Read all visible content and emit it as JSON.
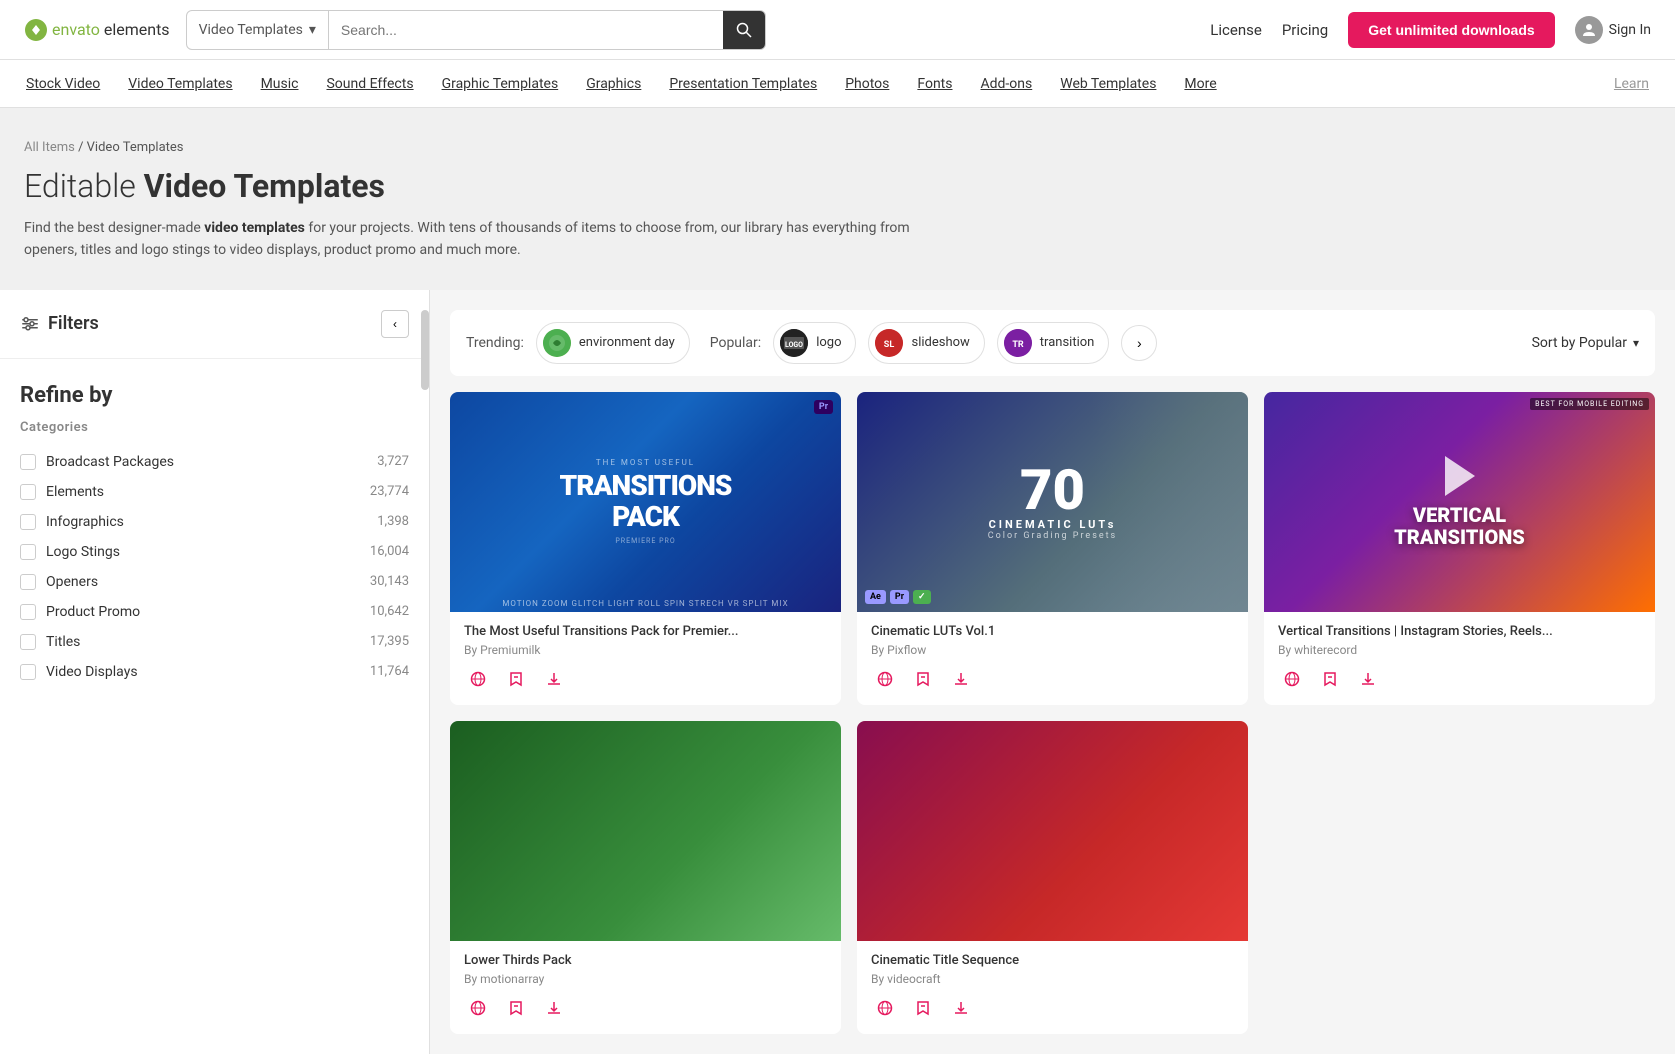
{
  "header": {
    "logo_envato": "envato",
    "logo_elements": "elements",
    "search_category": "Video Templates",
    "search_placeholder": "Search...",
    "nav_license": "License",
    "nav_pricing": "Pricing",
    "cta_button": "Get unlimited downloads",
    "sign_in": "Sign In"
  },
  "nav_items": [
    {
      "label": "Stock Video",
      "id": "stock-video"
    },
    {
      "label": "Video Templates",
      "id": "video-templates"
    },
    {
      "label": "Music",
      "id": "music"
    },
    {
      "label": "Sound Effects",
      "id": "sound-effects"
    },
    {
      "label": "Graphic Templates",
      "id": "graphic-templates"
    },
    {
      "label": "Graphics",
      "id": "graphics"
    },
    {
      "label": "Presentation Templates",
      "id": "presentation-templates"
    },
    {
      "label": "Photos",
      "id": "photos"
    },
    {
      "label": "Fonts",
      "id": "fonts"
    },
    {
      "label": "Add-ons",
      "id": "add-ons"
    },
    {
      "label": "Web Templates",
      "id": "web-templates"
    },
    {
      "label": "More",
      "id": "more"
    },
    {
      "label": "Learn",
      "id": "learn"
    }
  ],
  "breadcrumb": {
    "all_items": "All Items",
    "separator": "/",
    "current": "Video Templates"
  },
  "page": {
    "title_light": "Editable",
    "title_bold": "Video Templates",
    "description": "Find the best designer-made video templates for your projects. With tens of thousands of items to choose from, our library has everything from openers, titles and logo stings to video displays, product promo and much more.",
    "description_bold": "video templates"
  },
  "sidebar": {
    "filters_label": "Filters",
    "refine_by": "Refine by",
    "categories_label": "Categories",
    "categories": [
      {
        "name": "Broadcast Packages",
        "count": "3,727"
      },
      {
        "name": "Elements",
        "count": "23,774"
      },
      {
        "name": "Infographics",
        "count": "1,398"
      },
      {
        "name": "Logo Stings",
        "count": "16,004"
      },
      {
        "name": "Openers",
        "count": "30,143"
      },
      {
        "name": "Product Promo",
        "count": "10,642"
      },
      {
        "name": "Titles",
        "count": "17,395"
      },
      {
        "name": "Video Displays",
        "count": "11,764"
      }
    ]
  },
  "trending": {
    "trending_label": "Trending:",
    "popular_label": "Popular:",
    "tags": [
      {
        "label": "environment day",
        "id": "env-day"
      },
      {
        "label": "logo",
        "id": "logo"
      },
      {
        "label": "slideshow",
        "id": "slideshow"
      },
      {
        "label": "transition",
        "id": "transition"
      }
    ],
    "sort_by": "Sort by Popular"
  },
  "items": [
    {
      "id": "item-1",
      "title": "The Most Useful Transitions Pack for Premier...",
      "author": "By Premiumilk",
      "thumb_type": "transitions"
    },
    {
      "id": "item-2",
      "title": "Cinematic LUTs Vol.1",
      "author": "By Pixflow",
      "thumb_type": "luts"
    },
    {
      "id": "item-3",
      "title": "Vertical Transitions | Instagram Stories, Reels...",
      "author": "By whiterecord",
      "thumb_type": "vertical"
    },
    {
      "id": "item-4",
      "title": "Lower Thirds Pack",
      "author": "By motionarray",
      "thumb_type": "lower"
    },
    {
      "id": "item-5",
      "title": "Cinematic Title Sequence",
      "author": "By videocraft",
      "thumb_type": "lower2"
    }
  ],
  "colors": {
    "accent": "#e5195e",
    "brand_green": "#82b541"
  }
}
